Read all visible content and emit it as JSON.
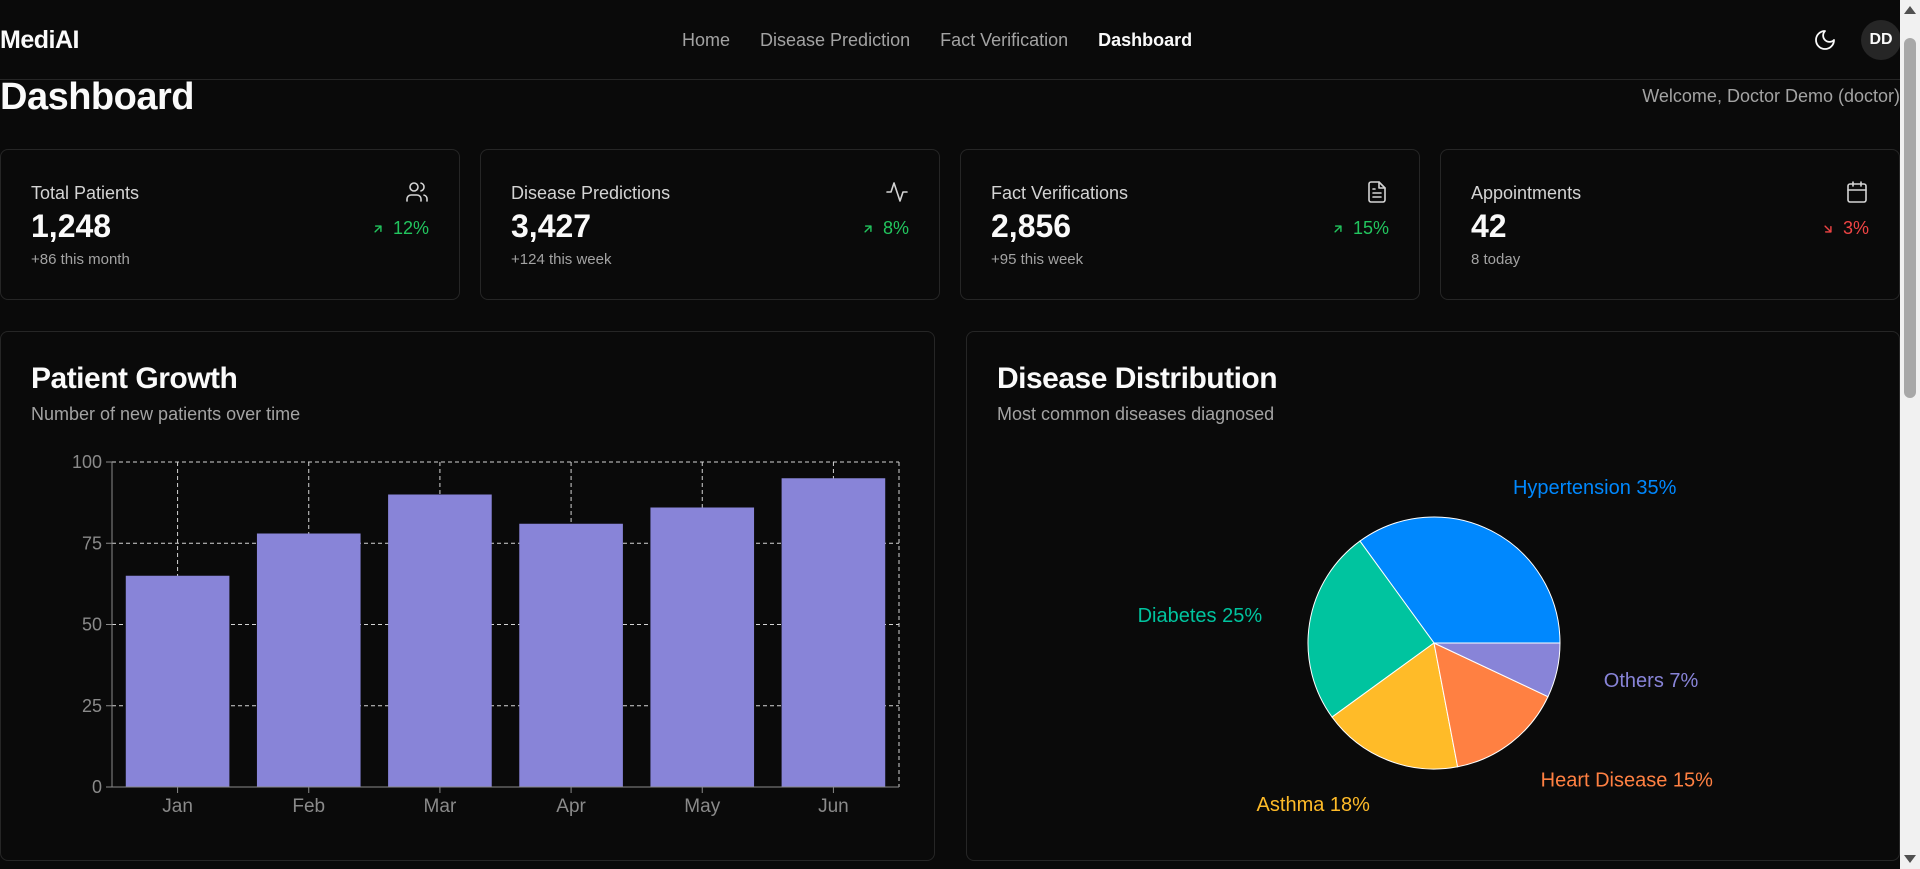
{
  "app": {
    "logo": "MediAI"
  },
  "nav": {
    "links": [
      "Home",
      "Disease Prediction",
      "Fact Verification",
      "Dashboard"
    ],
    "active": "Dashboard",
    "avatar_initials": "DD",
    "theme_icon": "moon-icon"
  },
  "header": {
    "title": "Dashboard",
    "welcome": "Welcome, Doctor Demo (doctor)"
  },
  "stats": [
    {
      "title": "Total Patients",
      "value": "1,248",
      "sub": "+86 this month",
      "trend": "12%",
      "direction": "up",
      "icon": "users-icon"
    },
    {
      "title": "Disease Predictions",
      "value": "3,427",
      "sub": "+124 this week",
      "trend": "8%",
      "direction": "up",
      "icon": "activity-icon"
    },
    {
      "title": "Fact Verifications",
      "value": "2,856",
      "sub": "+95 this week",
      "trend": "15%",
      "direction": "up",
      "icon": "file-text-icon"
    },
    {
      "title": "Appointments",
      "value": "42",
      "sub": "8 today",
      "trend": "3%",
      "direction": "down",
      "icon": "calendar-icon"
    }
  ],
  "panels": {
    "growth": {
      "title": "Patient Growth",
      "subtitle": "Number of new patients over time"
    },
    "distribution": {
      "title": "Disease Distribution",
      "subtitle": "Most common diseases diagnosed"
    }
  },
  "colors": {
    "bar": "#8884d8",
    "up": "#22c55e",
    "down": "#ef4444",
    "grid": "#d4d4d4",
    "axis_text": "#8a8a8a"
  },
  "chart_data": [
    {
      "type": "bar",
      "categories": [
        "Jan",
        "Feb",
        "Mar",
        "Apr",
        "May",
        "Jun"
      ],
      "values": [
        65,
        78,
        90,
        81,
        86,
        95
      ],
      "yticks": [
        0,
        25,
        50,
        75,
        100
      ],
      "ylim": [
        0,
        100
      ],
      "grid": true
    },
    {
      "type": "pie",
      "labels": [
        "Hypertension",
        "Diabetes",
        "Asthma",
        "Heart Disease",
        "Others"
      ],
      "values": [
        35,
        25,
        18,
        15,
        7
      ],
      "colors": [
        "#0088fe",
        "#00c49f",
        "#ffbb28",
        "#ff8042",
        "#8884d8"
      ],
      "label_text": [
        "Hypertension 35%",
        "Diabetes 25%",
        "Asthma 18%",
        "Heart Disease 15%",
        "Others 7%"
      ]
    }
  ]
}
